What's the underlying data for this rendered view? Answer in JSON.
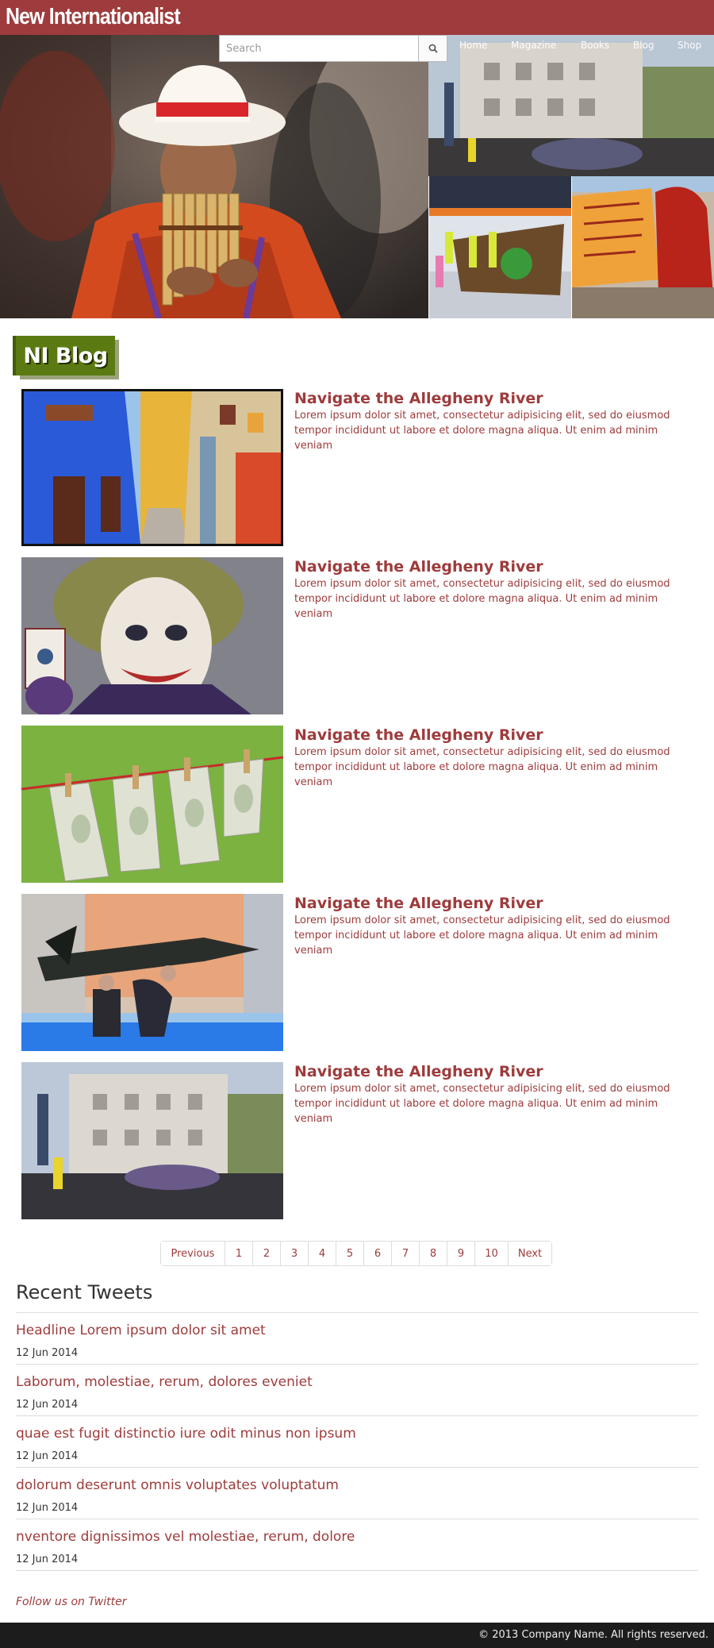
{
  "header": {
    "brand": "New Internationalist",
    "search": {
      "placeholder": "Search",
      "value": ""
    },
    "nav": [
      "Home",
      "Magazine",
      "Books",
      "Blog",
      "Shop"
    ]
  },
  "hero": {
    "images": [
      "panpipe-player-photo",
      "building-protest-photo",
      "march-banner-photo",
      "protest-banner-photo"
    ]
  },
  "blog": {
    "badge": "NI Blog",
    "posts": [
      {
        "title": "Navigate the Allegheny River",
        "excerpt": "Lorem ipsum dolor sit amet, consectetur adipisicing elit, sed do eiusmod tempor incididunt ut labore et dolore magna aliqua. Ut enim ad minim veniam",
        "image": "colorful-street-photo"
      },
      {
        "title": "Navigate the Allegheny River",
        "excerpt": "Lorem ipsum dolor sit amet, consectetur adipisicing elit, sed do eiusmod tempor incididunt ut labore et dolore magna aliqua. Ut enim ad minim veniam",
        "image": "joker-photo"
      },
      {
        "title": "Navigate the Allegheny River",
        "excerpt": "Lorem ipsum dolor sit amet, consectetur adipisicing elit, sed do eiusmod tempor incididunt ut labore et dolore magna aliqua. Ut enim ad minim veniam",
        "image": "money-clothesline-photo"
      },
      {
        "title": "Navigate the Allegheny River",
        "excerpt": "Lorem ipsum dolor sit amet, consectetur adipisicing elit, sed do eiusmod tempor incididunt ut labore et dolore magna aliqua. Ut enim ad minim veniam",
        "image": "missile-exhibition-photo"
      },
      {
        "title": "Navigate the Allegheny River",
        "excerpt": "Lorem ipsum dolor sit amet, consectetur adipisicing elit, sed do eiusmod tempor incididunt ut labore et dolore magna aliqua. Ut enim ad minim veniam",
        "image": "building-crowd-photo"
      }
    ]
  },
  "pagination": {
    "previous": "Previous",
    "pages": [
      "1",
      "2",
      "3",
      "4",
      "5",
      "6",
      "7",
      "8",
      "9",
      "10"
    ],
    "next": "Next"
  },
  "tweets": {
    "title": "Recent Tweets",
    "items": [
      {
        "headline": "Headline Lorem ipsum dolor sit amet",
        "date": "12 Jun 2014"
      },
      {
        "headline": "Laborum, molestiae, rerum, dolores eveniet",
        "date": "12 Jun 2014"
      },
      {
        "headline": "quae est fugit distinctio iure odit minus non ipsum",
        "date": "12 Jun 2014"
      },
      {
        "headline": "dolorum deserunt omnis voluptates voluptatum",
        "date": "12 Jun 2014"
      },
      {
        "headline": "nventore dignissimos vel molestiae, rerum, dolore",
        "date": "12 Jun 2014"
      }
    ],
    "follow": "Follow us on Twitter"
  },
  "footer": {
    "copyright": "© 2013 Company Name. All rights reserved."
  },
  "colors": {
    "brand": "#9e3b3c",
    "badge": "#5c7a12",
    "footer": "#1c1c1c"
  }
}
